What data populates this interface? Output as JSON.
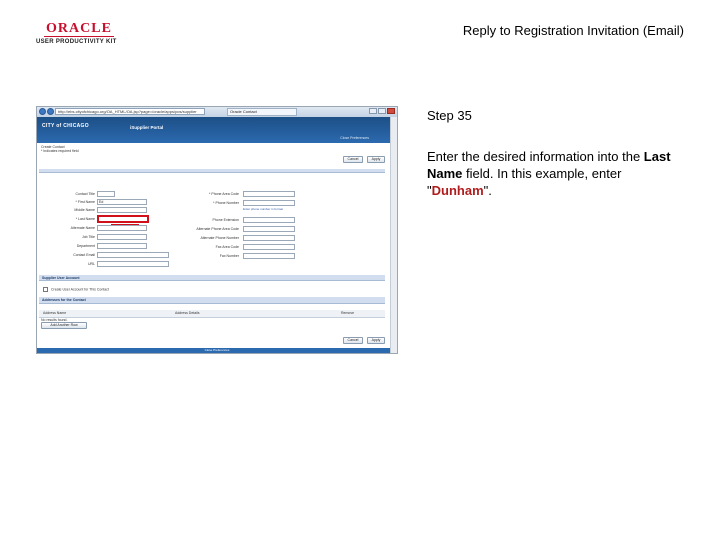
{
  "slide": {
    "logo_brand": "ORACLE",
    "logo_subtitle": "USER PRODUCTIVITY KIT",
    "title": "Reply to Registration Invitation (Email)",
    "step": "Step 35",
    "instruction_pre": "Enter the desired information into the ",
    "instruction_field": "Last Name",
    "instruction_mid": " field. In this example, enter \"",
    "instruction_value": "Dunham",
    "instruction_post": "\"."
  },
  "colors": {
    "oracle_red": "#c8102e",
    "app_header_blue": "#1c4f86",
    "highlight_red": "#d0101a"
  },
  "screenshot": {
    "browser_url": "http://ebs.cityofchicago.org/OA_HTML/OA.jsp?page=/oracle/apps/pos/supplier",
    "browser_tab": "Oracle Contact",
    "app_title": "CITY of CHICAGO",
    "app_name": "iSupplier Portal",
    "header_links": "Close   Preferences",
    "page_heading": "Create Contact",
    "required_note": "* Indicates required field",
    "cancel_label": "Cancel",
    "apply_label": "Apply",
    "form_left": [
      {
        "label": "Contact Title",
        "value": ""
      },
      {
        "label": "* First Name",
        "value": "Ed"
      },
      {
        "label": "Middle Name",
        "value": ""
      },
      {
        "label": "* Last Name",
        "value": ""
      },
      {
        "label": "Alternate Name",
        "value": ""
      },
      {
        "label": "Job Title",
        "value": ""
      },
      {
        "label": "Department",
        "value": ""
      },
      {
        "label": "Contact Email",
        "value": ""
      },
      {
        "label": "URL",
        "value": ""
      }
    ],
    "form_right": [
      {
        "label": "* Phone Area Code",
        "value": ""
      },
      {
        "label": "* Phone Number",
        "value": ""
      },
      {
        "label": "Phone Extension",
        "value": ""
      },
      {
        "label": "Alternate Phone Area Code",
        "value": ""
      },
      {
        "label": "Alternate Phone Number",
        "value": ""
      },
      {
        "label": "Fax Area Code",
        "value": ""
      },
      {
        "label": "Fax Number",
        "value": ""
      }
    ],
    "link_hint": "Enter phone number in format",
    "tip_text": "Dunham",
    "section_user_account": "Supplier User Account",
    "create_user_label": "Create User Account for This Contact",
    "section_addresses": "Addresses for the Contact",
    "col_address_name": "Address Name",
    "col_address_details": "Address Details",
    "col_remove": "Remove",
    "no_results": "No results found.",
    "add_another_label": "Add Another Row",
    "footer_links": "Close   Preferences"
  }
}
